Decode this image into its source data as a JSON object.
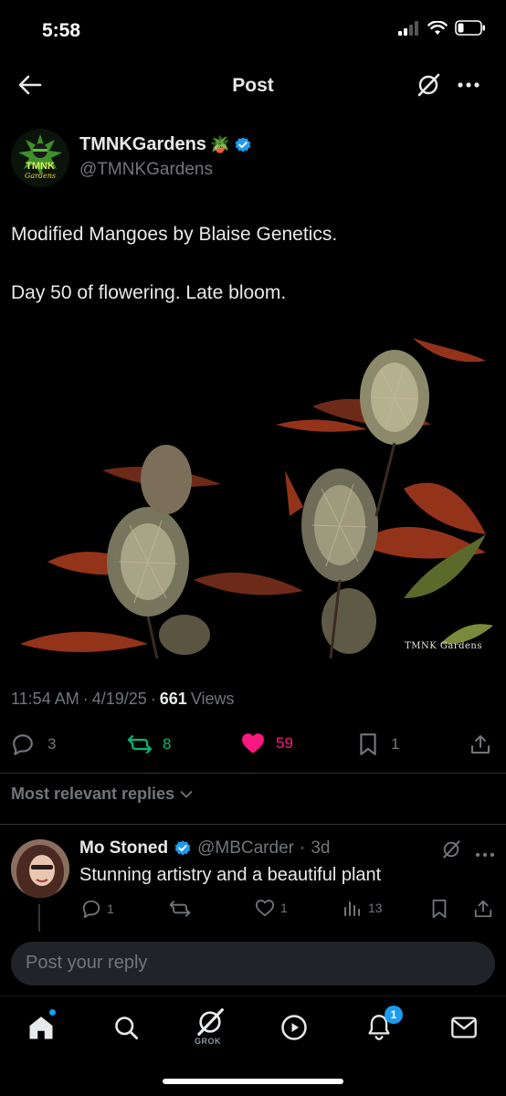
{
  "status_bar": {
    "time": "5:58"
  },
  "header": {
    "title": "Post"
  },
  "post": {
    "author_name": "TMNKGardens",
    "author_emoji": "🪴",
    "author_handle": "@TMNKGardens",
    "avatar_text_top": "TMNK",
    "avatar_text_bottom": "Gardens",
    "text": "Modified Mangoes by Blaise Genetics.\n\nDay 50 of flowering. Late bloom.",
    "image_watermark": "TMNK Gardens",
    "time": "11:54 AM",
    "date": "4/19/25",
    "views_count": "661",
    "views_label": "Views",
    "stats": {
      "replies": "3",
      "reposts": "8",
      "likes": "59",
      "bookmarks": "1"
    }
  },
  "replies_filter": {
    "label": "Most relevant replies"
  },
  "reply": {
    "name": "Mo Stoned",
    "handle": "@MBCarder",
    "age": "3d",
    "text": "Stunning artistry and a beautiful plant",
    "stats": {
      "replies": "1",
      "reposts": "",
      "likes": "1",
      "views": "13"
    }
  },
  "composer": {
    "placeholder": "Post your reply"
  },
  "tabbar": {
    "grok_label": "GROK",
    "notification_count": "1"
  },
  "colors": {
    "accent": "#1d9bf0",
    "like": "#f91880",
    "repost": "#00ba7c",
    "muted": "#71767b"
  }
}
